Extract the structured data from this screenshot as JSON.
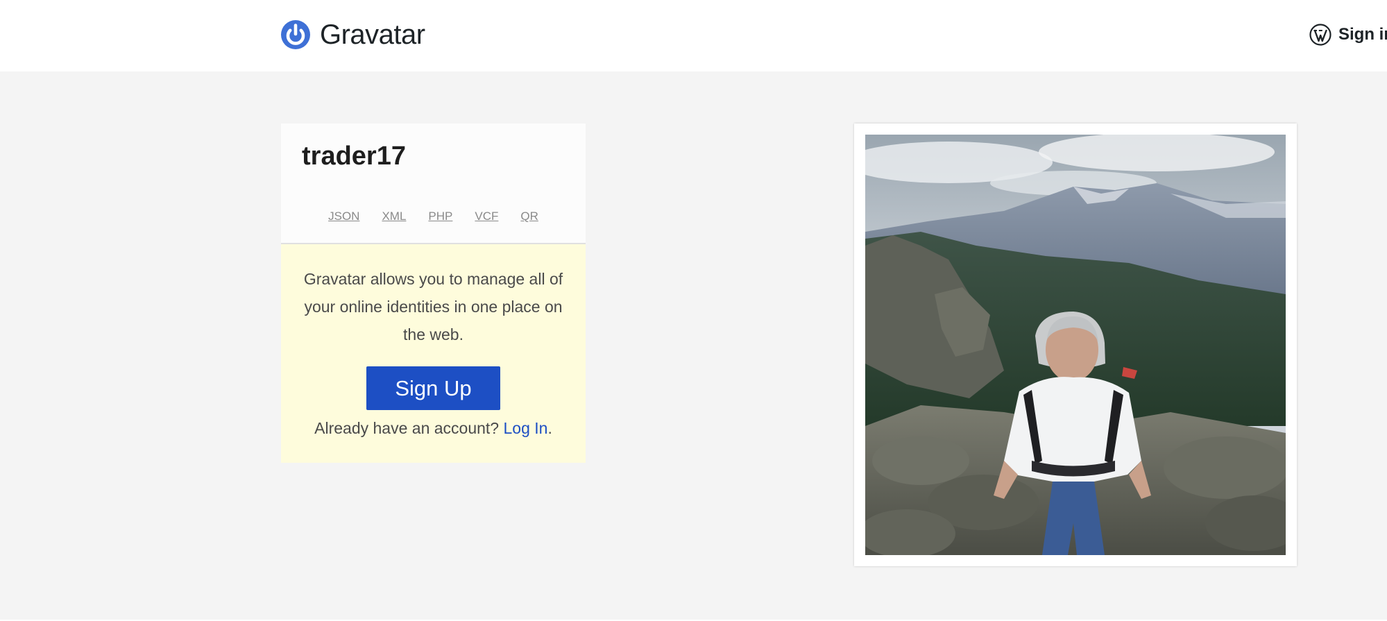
{
  "header": {
    "brand_name": "Gravatar",
    "brand_color": "#3e70d6",
    "signin_label": "Sign in",
    "signin_icon": "wordpress-icon"
  },
  "profile": {
    "username": "trader17",
    "formats": [
      "JSON",
      "XML",
      "PHP",
      "VCF",
      "QR"
    ]
  },
  "promo": {
    "text": "Gravatar allows you to manage all of your online identities in one place on the web.",
    "signup_label": "Sign Up",
    "login_prompt": "Already have an account?",
    "login_link": "Log In",
    "login_suffix": "."
  },
  "photo": {
    "subject": "profile-photo"
  },
  "colors": {
    "accent": "#1d4fc4",
    "promo_bg": "#fefcdc",
    "page_bg": "#f4f4f4"
  }
}
